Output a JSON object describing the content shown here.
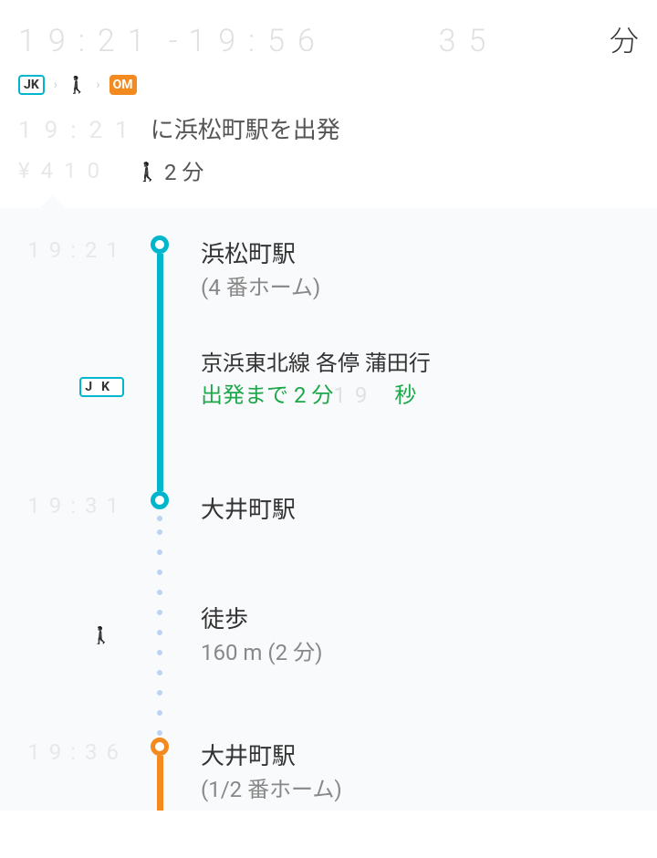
{
  "header": {
    "depart_time": "19:21",
    "arrive_time": "19:56",
    "time_sep": "-",
    "duration_value": "35",
    "duration_unit": "分",
    "badge_jk": "JK",
    "badge_om": "OM",
    "chevron": "›",
    "departure_time_label": "19:21",
    "departure_suffix": "に浜松町駅を出発",
    "fare": "¥410",
    "walk_summary": "2 分"
  },
  "steps": [
    {
      "time": "19:21",
      "station": "浜松町駅",
      "platform": "(4 番ホーム)"
    },
    {
      "line_name": "京浜東北線 各停 蒲田行",
      "countdown_prefix": "出発まで 2 分",
      "countdown_ghost": "19",
      "countdown_unit": "秒"
    },
    {
      "time": "19:31",
      "station": "大井町駅"
    },
    {
      "walk_label": "徒歩",
      "walk_detail": "160 m (2 分)"
    },
    {
      "time": "19:36",
      "station": "大井町駅",
      "platform": "(1/2 番ホーム)"
    }
  ]
}
